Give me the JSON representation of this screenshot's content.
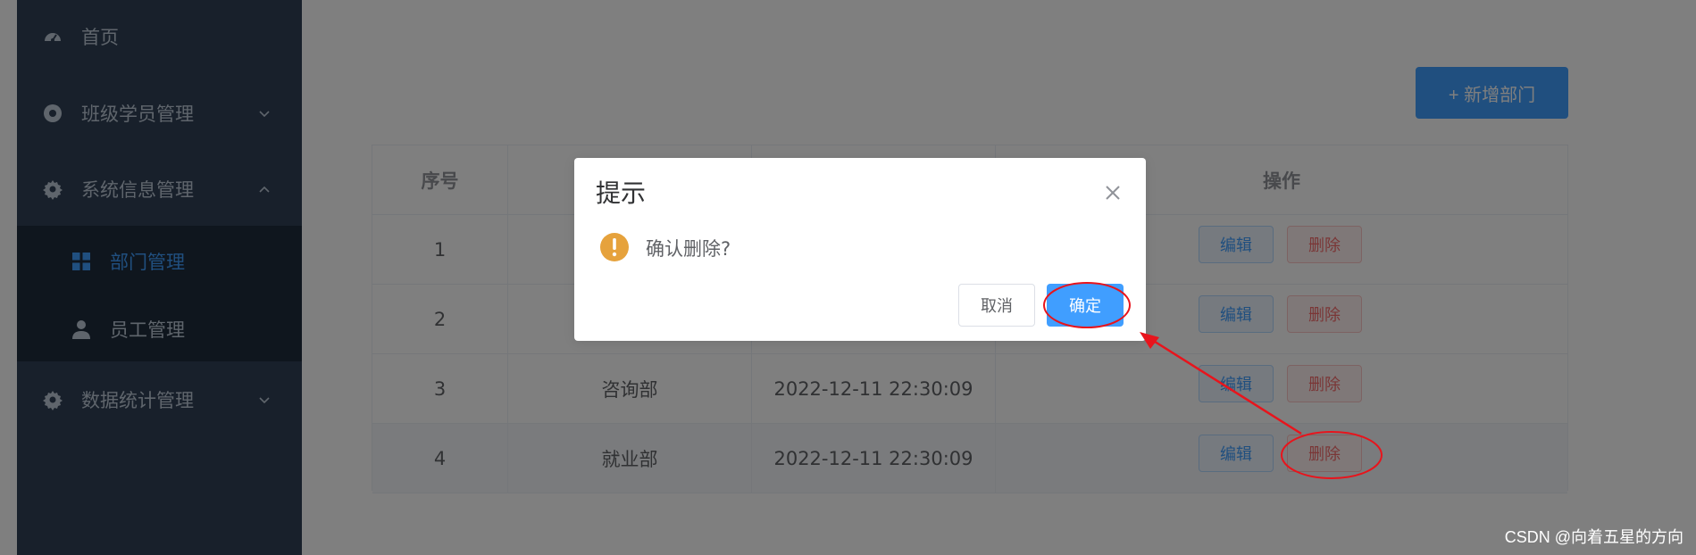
{
  "sidebar": {
    "items": [
      {
        "label": "首页",
        "icon": "dashboard-icon"
      },
      {
        "label": "班级学员管理",
        "icon": "circle-icon",
        "chevron": "chevron-down-icon"
      },
      {
        "label": "系统信息管理",
        "icon": "gear-icon",
        "chevron": "chevron-up-icon"
      },
      {
        "label": "数据统计管理",
        "icon": "gear-icon",
        "chevron": "chevron-down-icon"
      }
    ],
    "sub_items": [
      {
        "label": "部门管理",
        "icon": "grid-icon",
        "active": true
      },
      {
        "label": "员工管理",
        "icon": "user-icon",
        "active": false
      }
    ],
    "colors": {
      "background": "#304156",
      "submenu": "#1f2d3d",
      "text": "#bfcbd9",
      "active": "#409eff"
    }
  },
  "toolbar": {
    "add_label": "+ 新增部门"
  },
  "table": {
    "headers": [
      "序号",
      "",
      "",
      "操作"
    ],
    "rows": [
      {
        "index": "1",
        "name": "",
        "time": ""
      },
      {
        "index": "2",
        "name": "",
        "time": ""
      },
      {
        "index": "3",
        "name": "咨询部",
        "time": "2022-12-11 22:30:09"
      },
      {
        "index": "4",
        "name": "就业部",
        "time": "2022-12-11 22:30:09"
      }
    ],
    "actions": {
      "edit": "编辑",
      "delete": "删除"
    }
  },
  "dialog": {
    "title": "提示",
    "message": "确认删除?",
    "cancel": "取消",
    "confirm": "确定",
    "icons": {
      "close": "close-icon",
      "warning": "warning-icon"
    }
  },
  "watermark": "CSDN @向着五星的方向",
  "colors": {
    "primary": "#409eff",
    "danger": "#f56c6c",
    "warning": "#e6a23c",
    "annotation": "#e8141c"
  }
}
